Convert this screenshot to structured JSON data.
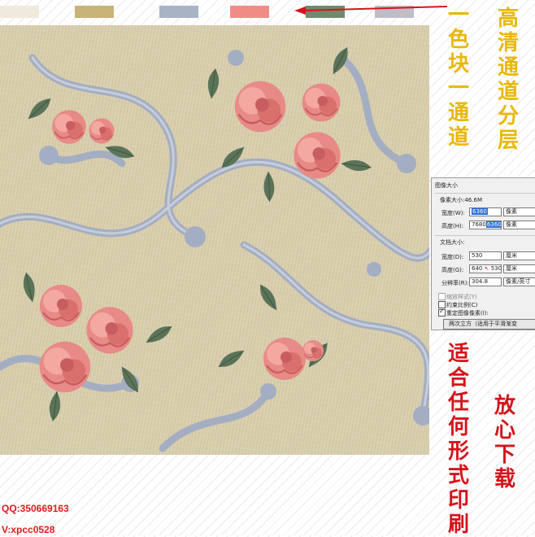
{
  "swatches": [
    {
      "name": "cream",
      "color": "#efeadc"
    },
    {
      "name": "khaki",
      "color": "#c8b477"
    },
    {
      "name": "blue-grey",
      "color": "#a8b4c6"
    },
    {
      "name": "coral",
      "color": "#ee8d86"
    },
    {
      "name": "green",
      "color": "#6f8a6c"
    },
    {
      "name": "light-grey",
      "color": "#c2bcc6"
    }
  ],
  "side_text": {
    "left_column": "一色块一通道",
    "right_column": "高清通道分层",
    "middle_column": "适合任何形式印刷",
    "lower_right_column": "放心下载"
  },
  "dialog": {
    "title": "图像大小",
    "pixel_size": "像素大小:46.6M",
    "width_label": "宽度(W):",
    "width_value": "6360",
    "width_unit": "像素",
    "height_label": "高度(H):",
    "height_value_old": "7680",
    "height_value_new": "6360",
    "height_unit": "像素",
    "doc_size": "文档大小:",
    "doc_width_label": "宽度(D):",
    "doc_width_value": "530",
    "doc_width_unit": "厘米",
    "doc_height_label": "高度(G):",
    "doc_height_value_old": "640",
    "doc_height_value_new": "530",
    "doc_height_unit": "厘米",
    "resolution_label": "分辨率(R):",
    "resolution_value": "304.8",
    "resolution_unit": "像素/英寸",
    "scale_styles": "缩放样式(Y)",
    "constrain": "约束比例(C)",
    "resample": "重定图像像素(I):",
    "resample_method": "两次立方（适用于平滑渐变"
  },
  "contact": {
    "qq": "QQ:350669163",
    "wechat": "V:xpcc0528"
  }
}
